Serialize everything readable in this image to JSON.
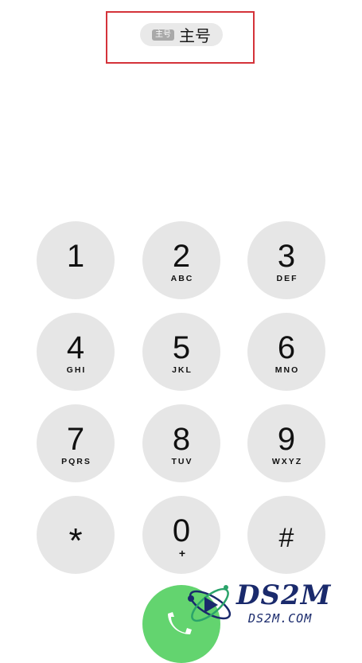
{
  "sim": {
    "badge": "主号",
    "name": "主号"
  },
  "keys": [
    {
      "digit": "1",
      "letters": ""
    },
    {
      "digit": "2",
      "letters": "ABC"
    },
    {
      "digit": "3",
      "letters": "DEF"
    },
    {
      "digit": "4",
      "letters": "GHI"
    },
    {
      "digit": "5",
      "letters": "JKL"
    },
    {
      "digit": "6",
      "letters": "MNO"
    },
    {
      "digit": "7",
      "letters": "PQRS"
    },
    {
      "digit": "8",
      "letters": "TUV"
    },
    {
      "digit": "9",
      "letters": "WXYZ"
    },
    {
      "digit": "*",
      "letters": ""
    },
    {
      "digit": "0",
      "letters": "+"
    },
    {
      "digit": "#",
      "letters": ""
    }
  ],
  "watermark": {
    "title": "DS2M",
    "subtitle": "DS2M.COM"
  },
  "colors": {
    "key_bg": "#e6e6e6",
    "call_green": "#63d46f",
    "highlight": "#d4333a"
  },
  "icons": {
    "call": "phone-icon"
  }
}
